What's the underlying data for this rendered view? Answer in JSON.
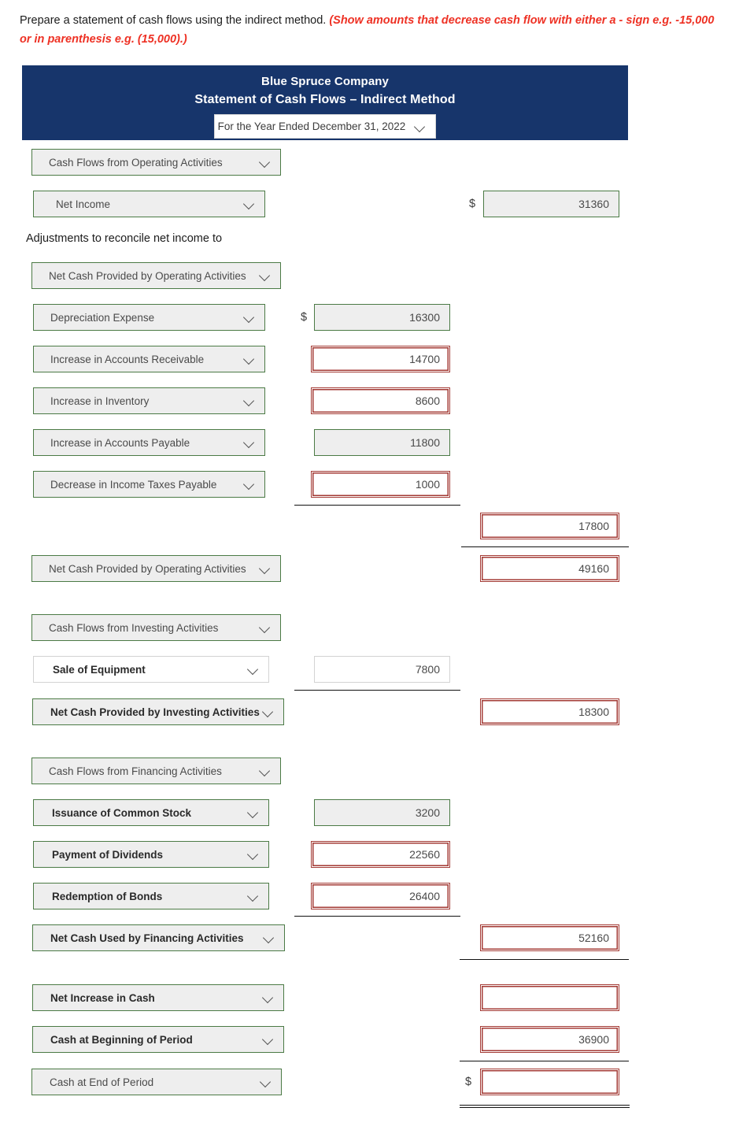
{
  "instruction": {
    "text": "Prepare a statement of cash flows using the indirect method.",
    "emphasis": "(Show amounts that decrease cash flow with either a - sign e.g. -15,000 or in parenthesis e.g. (15,000).)"
  },
  "statement_header": {
    "company": "Blue Spruce Company",
    "title": "Statement of Cash Flows – Indirect Method",
    "period": "For the Year Ended December 31, 2022"
  },
  "adjustments_note": "Adjustments to reconcile net income to",
  "currency_symbol": "$",
  "colors": {
    "header_navy": "#17356b",
    "correct_border": "#4b7a45",
    "error_border": "#a33a34",
    "emphasis_red": "#ee3124",
    "field_fill": "#eeeeee"
  },
  "rows": [
    {
      "label": "Cash Flows from Operating Activities",
      "label_style": "gray",
      "amount": null
    },
    {
      "label": "Net Income",
      "label_style": "gray",
      "amount": "31360",
      "amount_col": 3,
      "amount_state": "ok",
      "dollar": true
    },
    {
      "label": "Net Cash Provided by Operating Activities",
      "label_style": "gray",
      "amount": null
    },
    {
      "label": "Depreciation Expense",
      "label_style": "gray",
      "amount": "16300",
      "amount_col": 2,
      "amount_state": "ok",
      "dollar": true
    },
    {
      "label": "Increase in Accounts Receivable",
      "label_style": "gray",
      "amount": "14700",
      "amount_col": 2,
      "amount_state": "err"
    },
    {
      "label": "Increase in Inventory",
      "label_style": "gray",
      "amount": "8600",
      "amount_col": 2,
      "amount_state": "err"
    },
    {
      "label": "Increase in Accounts Payable",
      "label_style": "gray",
      "amount": "11800",
      "amount_col": 2,
      "amount_state": "ok"
    },
    {
      "label": "Decrease in Income Taxes Payable",
      "label_style": "gray",
      "amount": "1000",
      "amount_col": 2,
      "amount_state": "err"
    },
    {
      "label": null,
      "amount": "17800",
      "amount_col": 3,
      "amount_state": "err"
    },
    {
      "label": "Net Cash Provided by Operating Activities",
      "label_style": "gray",
      "amount": "49160",
      "amount_col": 3,
      "amount_state": "err"
    },
    {
      "label": "Cash Flows from Investing Activities",
      "label_style": "gray",
      "amount": null
    },
    {
      "label": "Sale of Equipment",
      "label_style": "bold-white",
      "amount": "7800",
      "amount_col": 2,
      "amount_state": "plain"
    },
    {
      "label": "Net Cash Provided by Investing Activities",
      "label_style": "bold",
      "amount": "18300",
      "amount_col": 3,
      "amount_state": "err"
    },
    {
      "label": "Cash Flows from Financing Activities",
      "label_style": "gray",
      "amount": null
    },
    {
      "label": "Issuance of Common Stock",
      "label_style": "bold",
      "amount": "3200",
      "amount_col": 2,
      "amount_state": "ok"
    },
    {
      "label": "Payment of Dividends",
      "label_style": "bold",
      "amount": "22560",
      "amount_col": 2,
      "amount_state": "err"
    },
    {
      "label": "Redemption of Bonds",
      "label_style": "bold",
      "amount": "26400",
      "amount_col": 2,
      "amount_state": "err"
    },
    {
      "label": "Net Cash Used by Financing Activities",
      "label_style": "bold",
      "amount": "52160",
      "amount_col": 3,
      "amount_state": "err"
    },
    {
      "label": "Net Increase in Cash",
      "label_style": "bold",
      "amount": "",
      "amount_col": 3,
      "amount_state": "err"
    },
    {
      "label": "Cash at Beginning of Period",
      "label_style": "bold",
      "amount": "36900",
      "amount_col": 3,
      "amount_state": "err"
    },
    {
      "label": "Cash at End of Period",
      "label_style": "gray",
      "amount": "",
      "amount_col": 3,
      "amount_state": "err",
      "dollar": true
    }
  ]
}
